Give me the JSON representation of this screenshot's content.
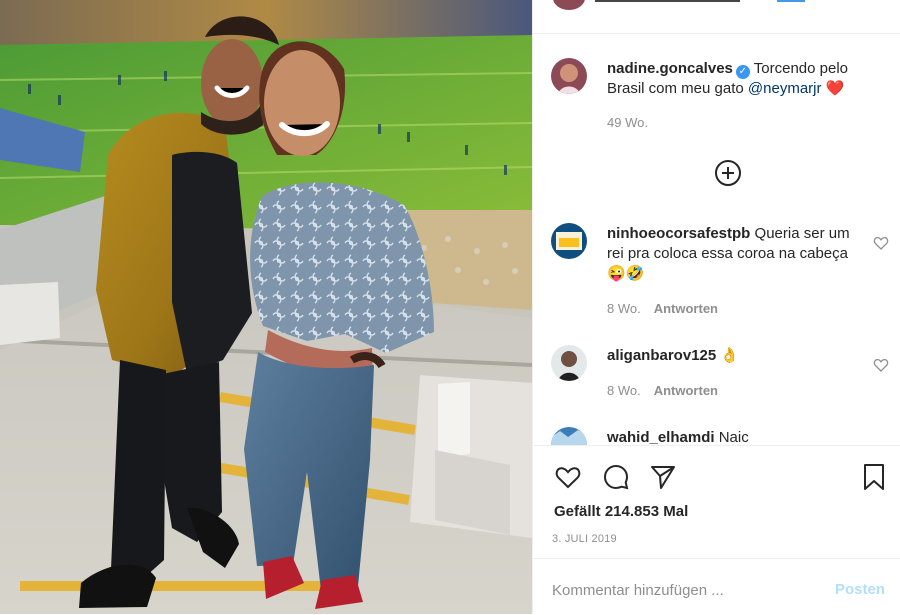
{
  "post": {
    "username": "nadine.goncalves",
    "caption_text": "Torcendo pelo Brasil com meu gato",
    "mention": "@neymarjr",
    "heart": "❤️",
    "time": "49 Wo."
  },
  "comments": [
    {
      "username": "ninhoeocorsafestpb",
      "text": "Queria ser um rei pra coloca essa coroa na cabeça",
      "emoji": "😜🤣",
      "time": "8 Wo.",
      "reply": "Antworten"
    },
    {
      "username": "aliganbarov125",
      "emoji": "👌",
      "time": "8 Wo.",
      "reply": "Antworten"
    },
    {
      "username": "wahid_elhamdi",
      "text": "Naic"
    }
  ],
  "actions": {
    "likes": "Gefällt 214.853 Mal",
    "date": "3. JULI 2019"
  },
  "comment_input": {
    "placeholder": "Kommentar hinzufügen ...",
    "post_label": "Posten"
  },
  "colors": {
    "link": "#00376b",
    "verified": "#3897f0",
    "muted": "#8e8e8e",
    "post_disabled": "#b2dffc"
  }
}
